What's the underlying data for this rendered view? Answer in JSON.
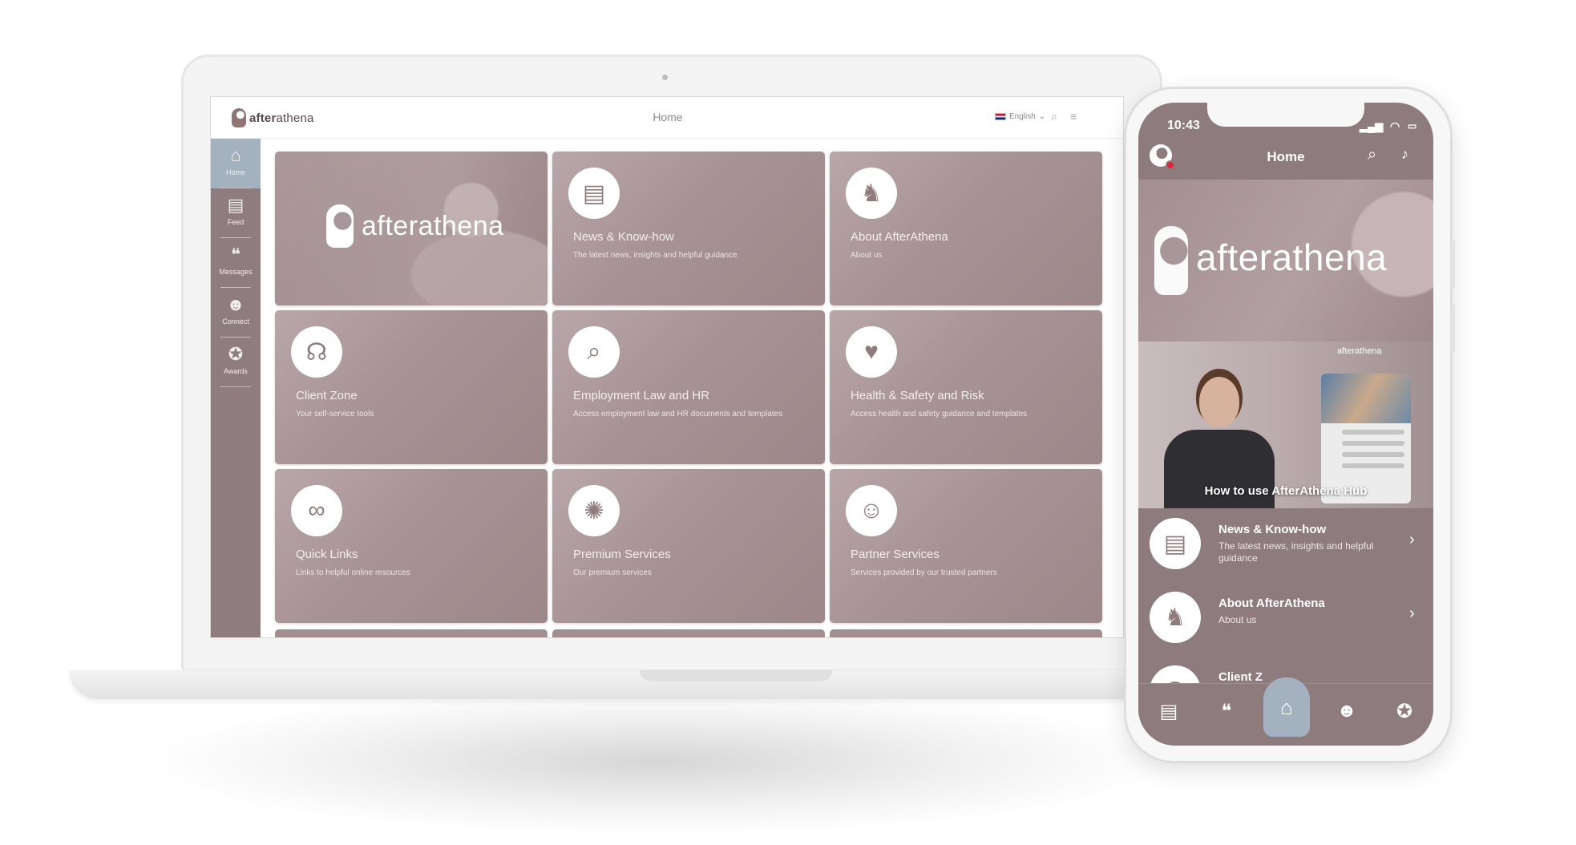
{
  "laptop": {
    "brand": {
      "prefix": "after",
      "suffix": "athena"
    },
    "page_title": "Home",
    "language": "English",
    "sidebar": [
      {
        "label": "Home",
        "icon": "home-icon",
        "glyph": "⌂"
      },
      {
        "label": "Feed",
        "icon": "feed-icon",
        "glyph": "▤"
      },
      {
        "label": "Messages",
        "icon": "messages-icon",
        "glyph": "❝"
      },
      {
        "label": "Connect",
        "icon": "connect-icon",
        "glyph": "☻"
      },
      {
        "label": "Awards",
        "icon": "awards-icon",
        "glyph": "✪"
      }
    ],
    "hero_logo": "afterathena",
    "tiles": [
      {
        "title": "News & Know-how",
        "subtitle": "The latest news, insights and helpful guidance",
        "icon": "newspaper-icon",
        "glyph": "▤"
      },
      {
        "title": "About AfterAthena",
        "subtitle": "About us",
        "icon": "athena-logo-icon",
        "glyph": "♞"
      },
      {
        "title": "Client Zone",
        "subtitle": "Your self-service tools",
        "icon": "client-zone-icon",
        "glyph": "☊"
      },
      {
        "title": "Employment Law and HR",
        "subtitle": "Access employment law and HR documents and templates",
        "icon": "briefcase-search-icon",
        "glyph": "⌕"
      },
      {
        "title": "Health & Safety and Risk",
        "subtitle": "Access health and safety guidance and templates",
        "icon": "health-hand-icon",
        "glyph": "♥"
      },
      {
        "title": "Quick Links",
        "subtitle": "Links to helpful online resources",
        "icon": "link-icon",
        "glyph": "∞"
      },
      {
        "title": "Premium Services",
        "subtitle": "Our premium services",
        "icon": "network-icon",
        "glyph": "✺"
      },
      {
        "title": "Partner Services",
        "subtitle": "Services provided by our trusted partners",
        "icon": "partner-icon",
        "glyph": "☺"
      }
    ]
  },
  "phone": {
    "time": "10:43",
    "title": "Home",
    "hero_logo": "afterathena",
    "video_logo": "afterathena",
    "video_caption": "How to use AfterAthena Hub",
    "list": [
      {
        "title": "News & Know-how",
        "subtitle": "The latest news, insights and helpful guidance",
        "icon": "newspaper-icon",
        "glyph": "▤"
      },
      {
        "title": "About AfterAthena",
        "subtitle": "About us",
        "icon": "athena-logo-icon",
        "glyph": "♞"
      },
      {
        "title": "Client Z",
        "subtitle": "",
        "icon": "client-zone-icon",
        "glyph": "☊"
      }
    ],
    "nav": [
      {
        "icon": "feed-icon",
        "glyph": "▤"
      },
      {
        "icon": "messages-icon",
        "glyph": "❝"
      },
      {
        "icon": "home-icon",
        "glyph": "⌂"
      },
      {
        "icon": "connect-icon",
        "glyph": "☻"
      },
      {
        "icon": "awards-icon",
        "glyph": "✪"
      }
    ]
  },
  "colors": {
    "brand_mauve": "#8e7b7d",
    "active_blue": "#a4b2c0",
    "notification_red": "#e0263c"
  }
}
